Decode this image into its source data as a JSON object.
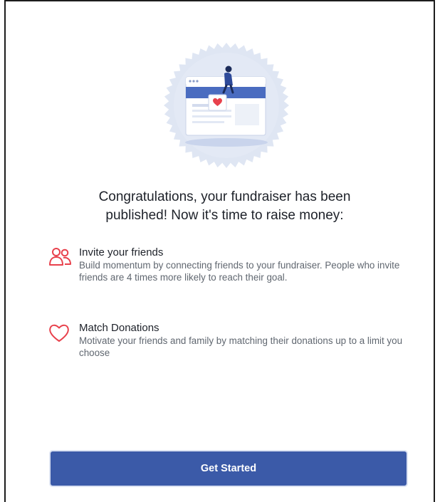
{
  "dialog": {
    "headline_line1": "Congratulations, your fundraiser has been",
    "headline_line2": "published! Now it's time to raise money:",
    "features": [
      {
        "icon": "people-icon",
        "title": "Invite your friends",
        "description": "Build momentum by connecting friends to your fundraiser. People who invite friends are 4 times more likely to reach their goal."
      },
      {
        "icon": "heart-icon",
        "title": "Match Donations",
        "description": "Motivate your friends and family by matching their donations up to a limit you choose"
      }
    ],
    "cta_label": "Get Started"
  },
  "colors": {
    "accent": "#3b5aa8",
    "icon": "#e8414c",
    "illustration_bg": "#dfe6f3",
    "text_primary": "#1d2129",
    "text_secondary": "#606770"
  }
}
